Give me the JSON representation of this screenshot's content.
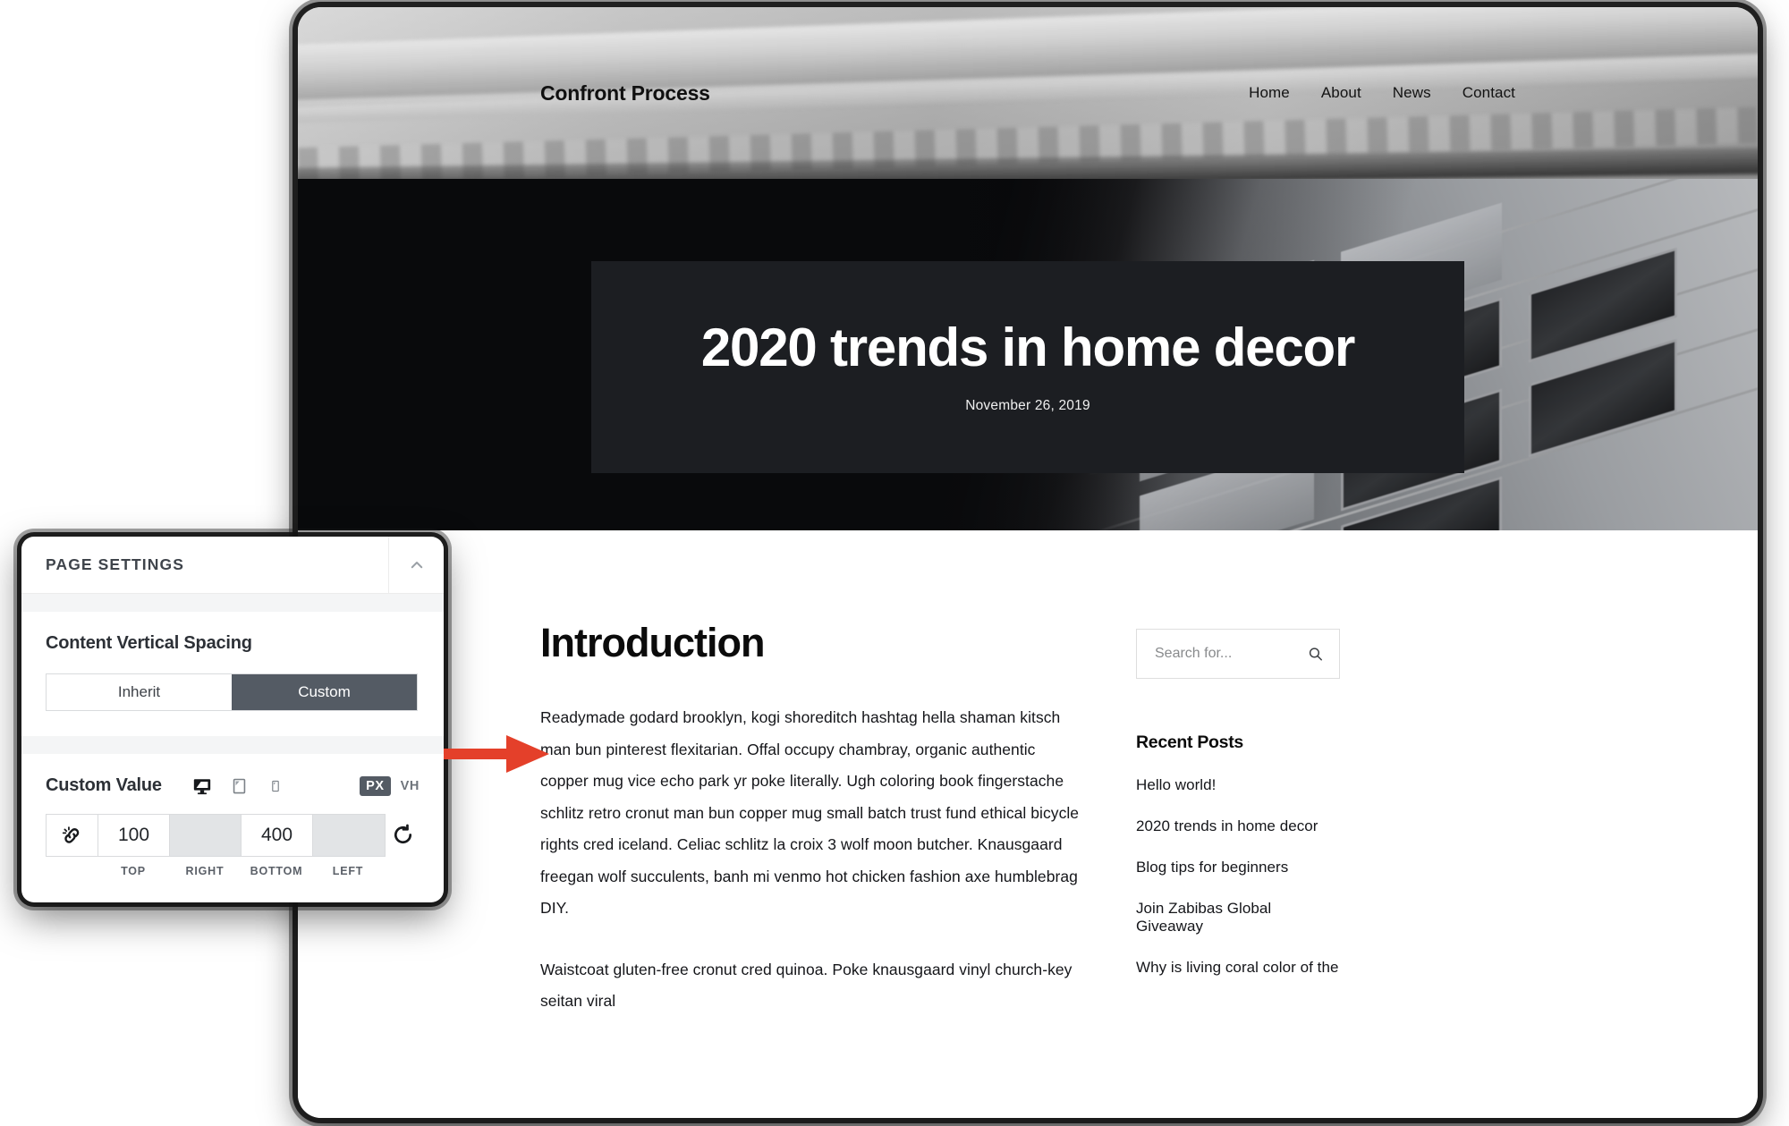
{
  "browser": {
    "site": {
      "logo": "Confront Process",
      "nav": [
        {
          "label": "Home"
        },
        {
          "label": "About"
        },
        {
          "label": "News"
        },
        {
          "label": "Contact"
        }
      ],
      "hero": {
        "title": "2020 trends in home decor",
        "date": "November 26, 2019"
      },
      "article": {
        "title": "Introduction",
        "paragraphs": [
          "Readymade godard brooklyn, kogi shoreditch hashtag hella shaman kitsch man bun pinterest flexitarian. Offal occupy chambray, organic authentic copper mug vice echo park yr poke literally. Ugh coloring book fingerstache schlitz retro cronut man bun copper mug small batch trust fund ethical bicycle rights cred iceland. Celiac schlitz la croix 3 wolf moon butcher. Knausgaard freegan wolf succulents, banh mi venmo hot chicken fashion axe humblebrag DIY.",
          "Waistcoat gluten-free cronut cred quinoa. Poke knausgaard vinyl church-key seitan viral"
        ]
      },
      "sidebar": {
        "search": {
          "placeholder": "Search for...",
          "value": "",
          "icon": "search-icon"
        },
        "recent_posts": {
          "title": "Recent Posts",
          "items": [
            {
              "label": "Hello world!"
            },
            {
              "label": "2020 trends in home decor"
            },
            {
              "label": "Blog tips for beginners"
            },
            {
              "label": "Join Zabibas Global Giveaway"
            },
            {
              "label": "Why is living coral color of the"
            }
          ]
        }
      }
    }
  },
  "panel": {
    "title": "PAGE SETTINGS",
    "collapse_icon": "chevron-up-icon",
    "content_vertical_spacing": {
      "label": "Content Vertical Spacing",
      "options": [
        {
          "label": "Inherit",
          "active": false
        },
        {
          "label": "Custom",
          "active": true
        }
      ]
    },
    "custom_value": {
      "label": "Custom Value",
      "devices": [
        {
          "name": "desktop-icon",
          "active": true
        },
        {
          "name": "tablet-icon",
          "active": false
        },
        {
          "name": "mobile-icon",
          "active": false
        }
      ],
      "units": [
        {
          "label": "PX",
          "active": true
        },
        {
          "label": "VH",
          "active": false
        }
      ],
      "link_icon": "unlink-icon",
      "reset_icon": "reset-icon",
      "fields": [
        {
          "legend": "TOP",
          "value": "100",
          "disabled": false
        },
        {
          "legend": "RIGHT",
          "value": "",
          "disabled": true
        },
        {
          "legend": "BOTTOM",
          "value": "400",
          "disabled": false
        },
        {
          "legend": "LEFT",
          "value": "",
          "disabled": true
        }
      ]
    }
  },
  "annotation": {
    "arrow_color": "#E4402A",
    "arrow_direction": "right"
  },
  "colors": {
    "accent_red": "#E4402A",
    "panel_active": "#545B64",
    "hero_card": "#1C1E22",
    "text_dark": "#15161A"
  }
}
